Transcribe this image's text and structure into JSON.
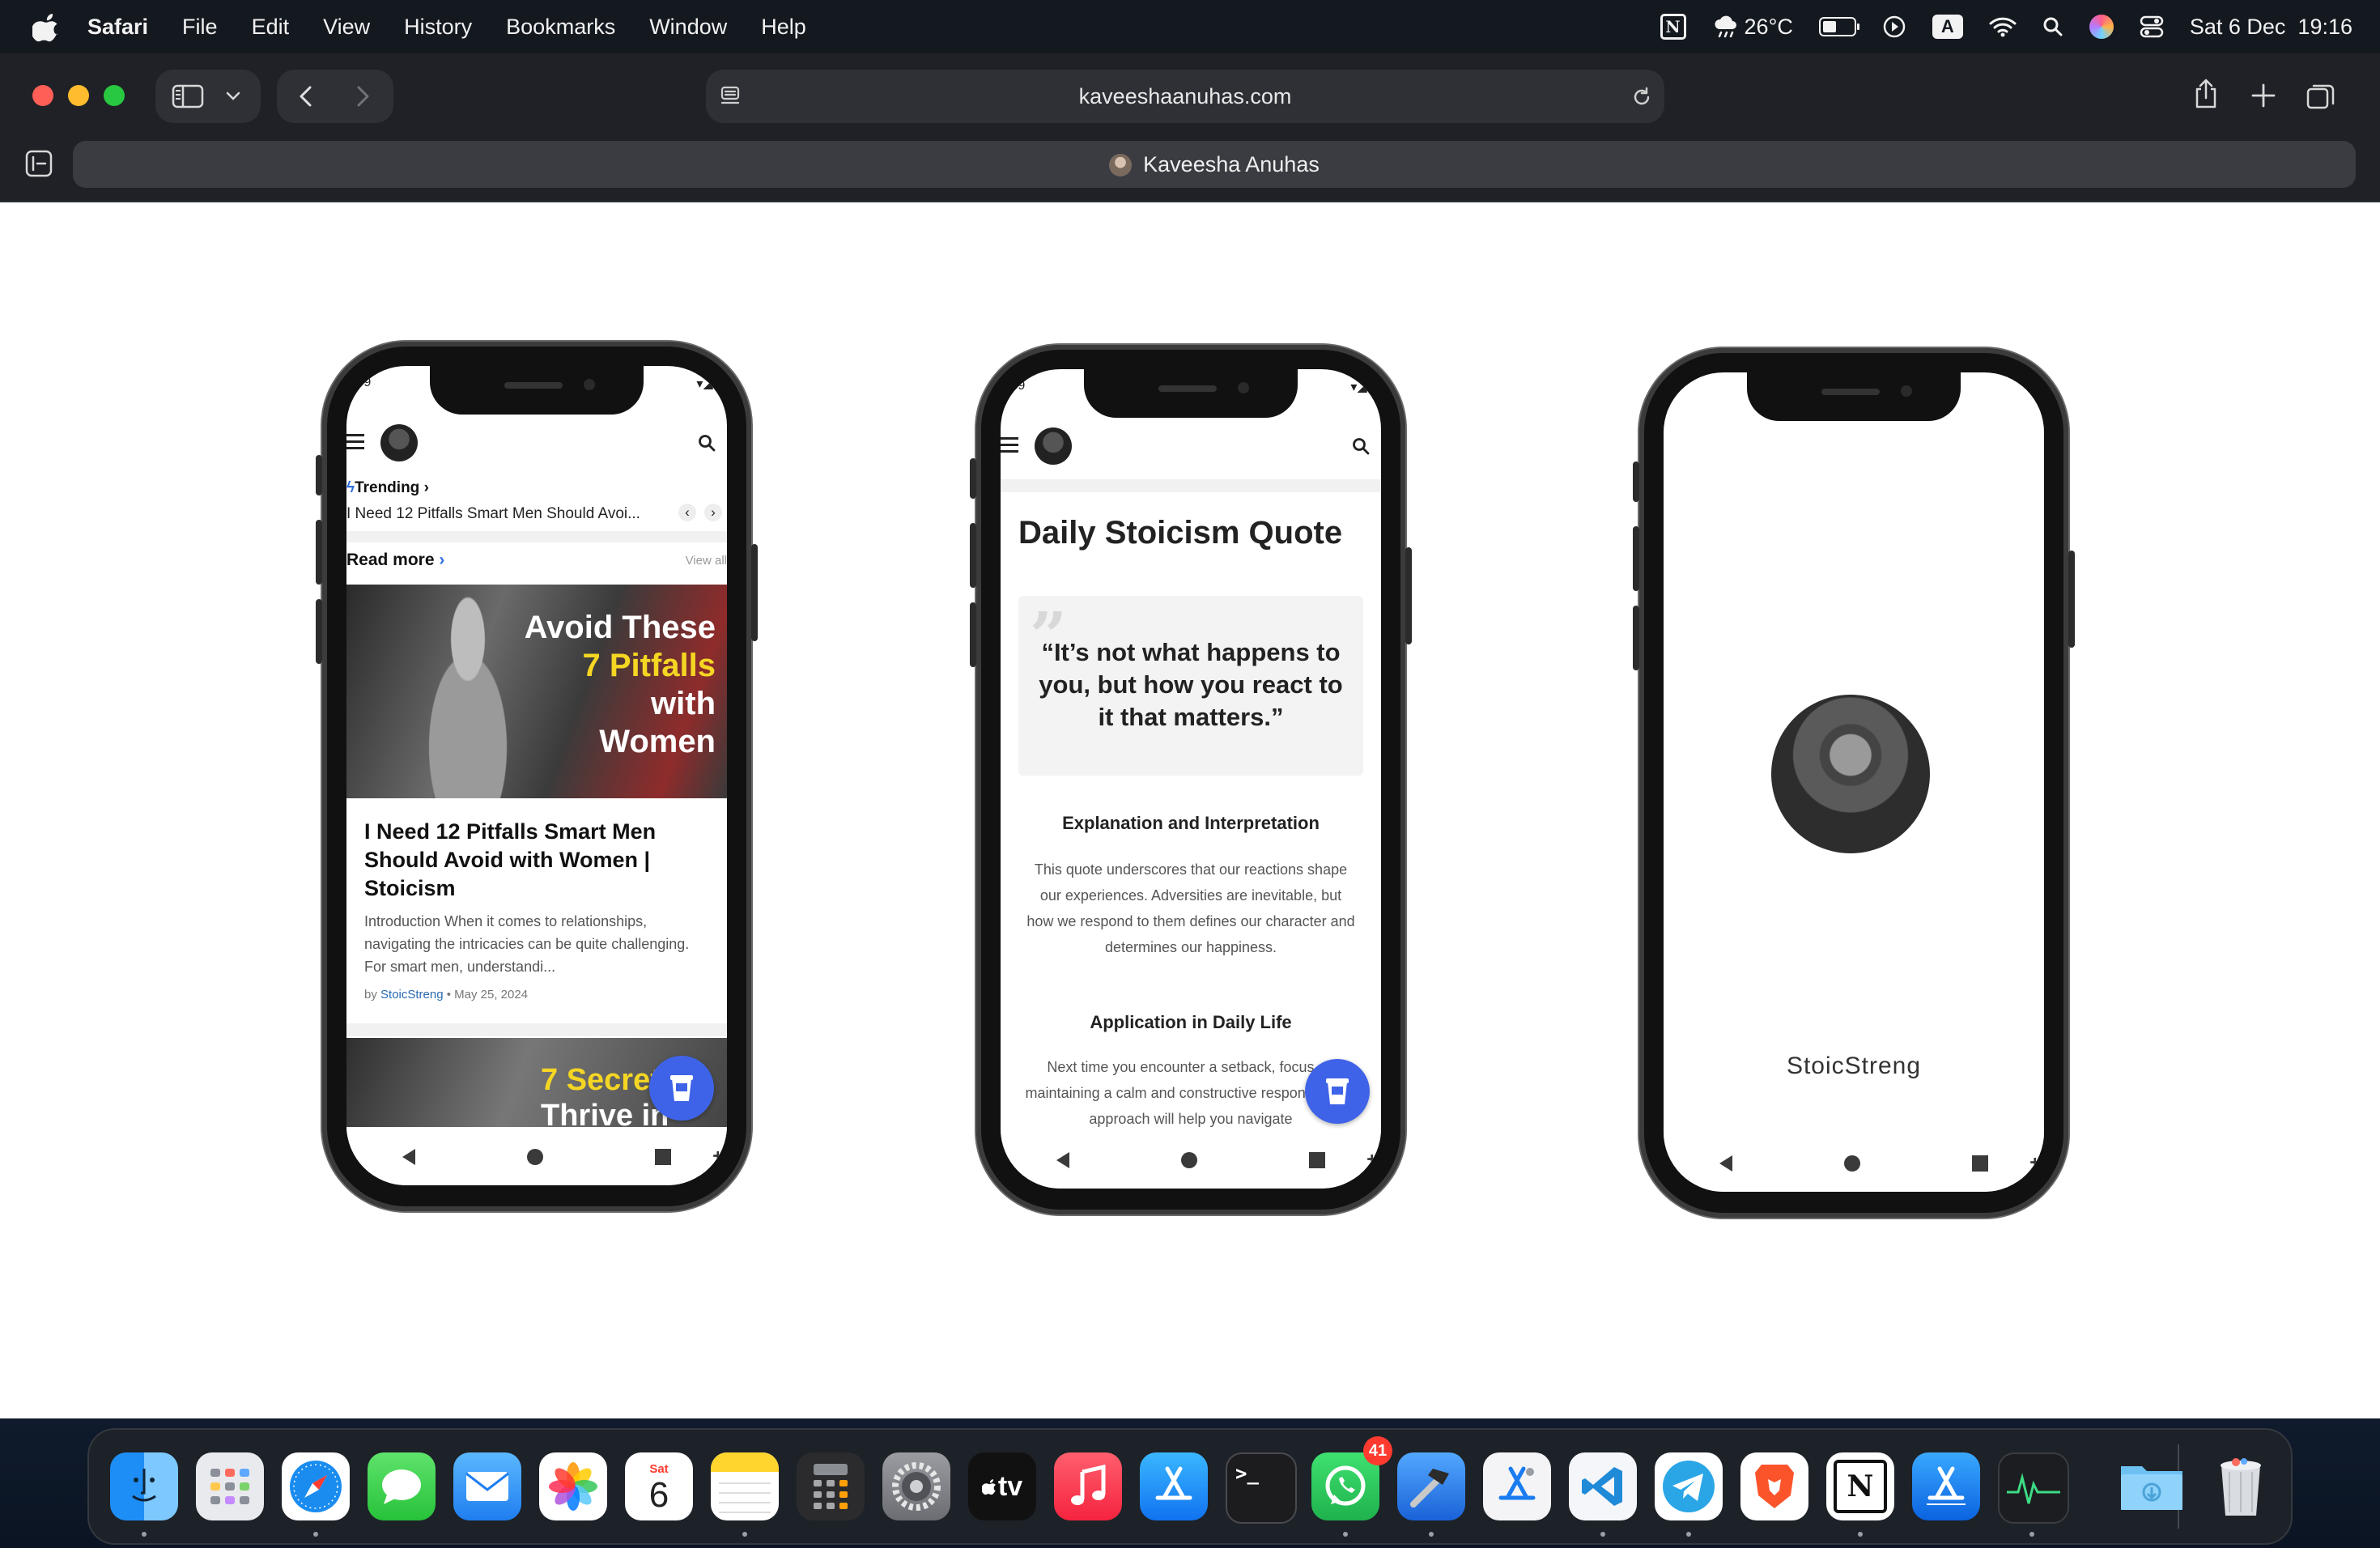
{
  "menubar": {
    "app_name": "Safari",
    "menus": [
      "File",
      "Edit",
      "View",
      "History",
      "Bookmarks",
      "Window",
      "Help"
    ],
    "weather": "26°C",
    "input_source": "A",
    "datetime": "Sat 6 Dec  19:16"
  },
  "browser": {
    "url": "kaveeshaanuhas.com",
    "tab_title": "Kaveesha Anuhas"
  },
  "phone1": {
    "time": ":59",
    "trending_label": "Trending",
    "trending_article": "I Need 12 Pitfalls Smart Men Should Avoi...",
    "read_more": "Read more",
    "view_all": "View all",
    "hero_lines": [
      "Avoid These",
      "7 Pitfalls",
      "with",
      "Women"
    ],
    "card_title": "I Need 12 Pitfalls Smart Men Should Avoid with Women | Stoicism",
    "card_excerpt": "Introduction When it comes to relationships, navigating the intricacies can be quite challenging. For smart men, understandi...",
    "card_by": "by",
    "card_author": "StoicStreng",
    "card_date": "• May 25, 2024",
    "hero2_line1": "7 Secret",
    "hero2_line2": "Thrive in"
  },
  "phone2": {
    "time": ":59",
    "title": "Daily Stoicism Quote",
    "quote": "“It’s not what happens to you, but how you react to it that matters.”",
    "heading1": "Explanation and Interpretation",
    "para1": "This quote underscores that our reactions shape our experiences. Adversities are inevitable, but how we respond to them defines our character and determines our happiness.",
    "heading2": "Application in Daily Life",
    "para2": "Next time you encounter a setback, focus on maintaining a calm and constructive response. This approach will help you navigate"
  },
  "phone3": {
    "brand_name": "StoicStreng"
  },
  "dock": {
    "calendar_month": "Sat",
    "calendar_day": "6",
    "whatsapp_badge": "41",
    "tv_label": "tv",
    "terminal_prompt": ">_"
  }
}
